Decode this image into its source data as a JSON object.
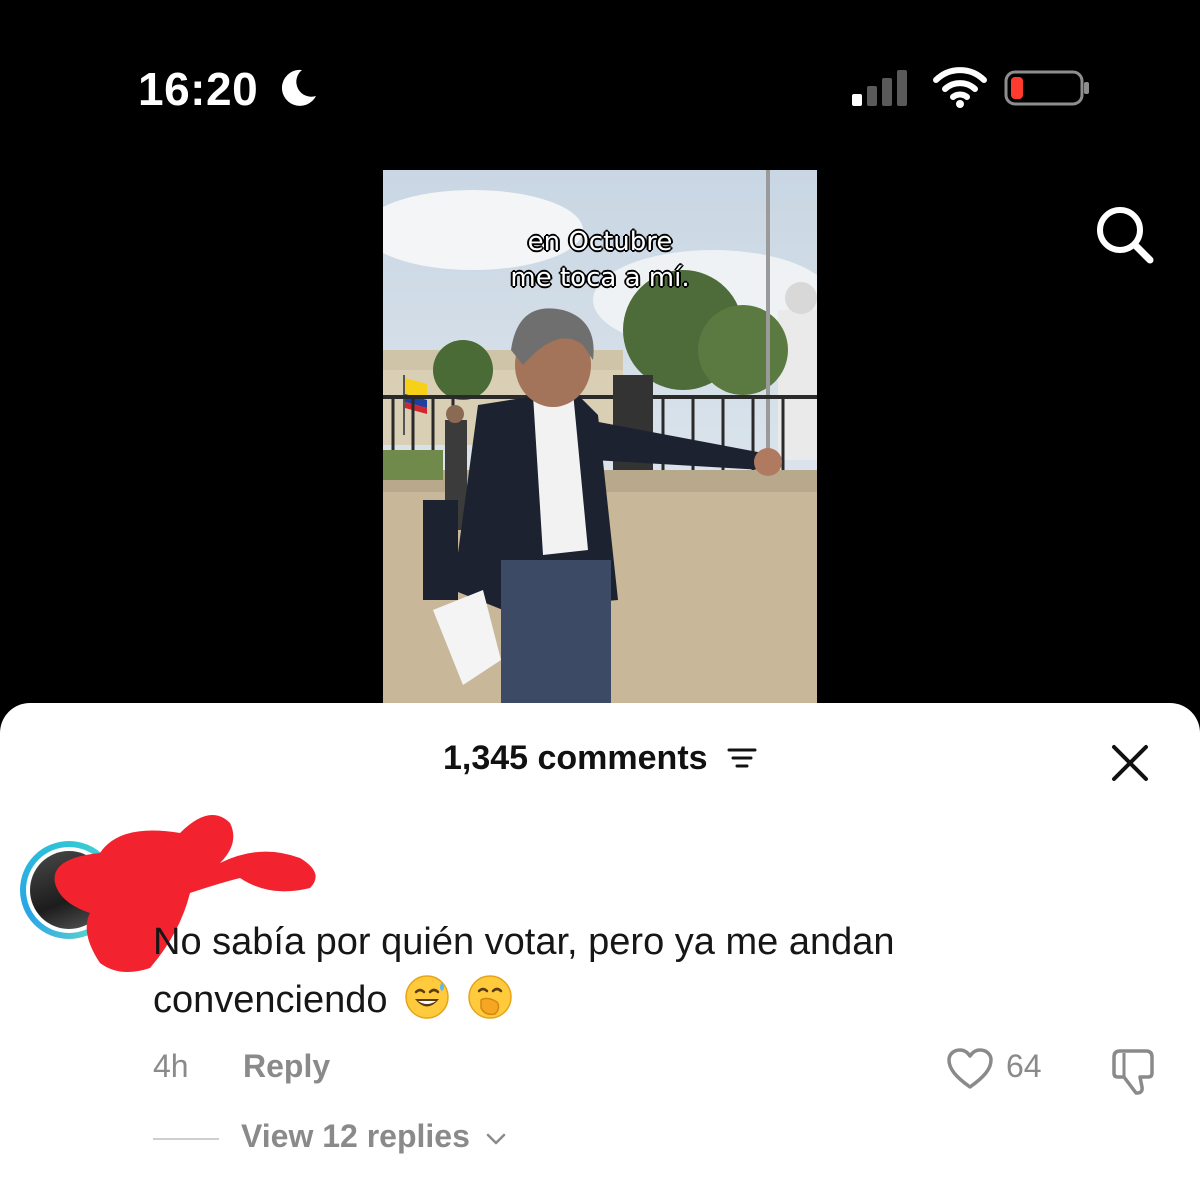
{
  "status_bar": {
    "time": "16:20",
    "moon_icon": "moon-icon",
    "signal_icon": "cellular-signal-icon",
    "wifi_icon": "wifi-icon",
    "battery_icon": "battery-low-icon",
    "battery_color": "#ff3b30"
  },
  "video": {
    "caption_line1": "en Octubre",
    "caption_line2": "me toca a mí."
  },
  "search_icon": "search-icon",
  "comments": {
    "header": "1,345 comments",
    "filter_icon": "filter-icon",
    "close_icon": "close-icon",
    "items": [
      {
        "text": "No sabía por quién votar, pero ya me andan convenciendo",
        "emoji": [
          "😅",
          "🤭"
        ],
        "time_ago": "4h",
        "reply_label": "Reply",
        "likes": "64",
        "view_replies": "View 12 replies"
      }
    ]
  },
  "colors": {
    "background": "#000000",
    "sheet": "#ffffff",
    "muted": "#8a8a8a",
    "redaction": "#f2232f",
    "avatar_ring": "#2ec5d8"
  }
}
